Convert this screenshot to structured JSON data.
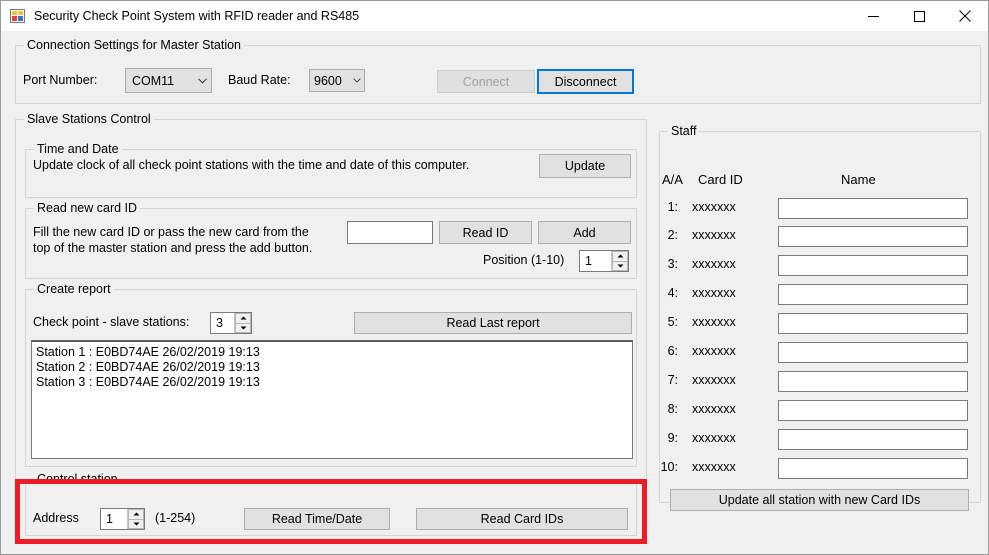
{
  "window": {
    "title": "Security Check Point System with RFID reader and RS485",
    "icon": "app-form-icon",
    "controls": {
      "minimize": "minimize-icon",
      "maximize": "maximize-icon",
      "close": "close-icon"
    }
  },
  "connection": {
    "group_title": "Connection Settings for Master Station",
    "port_label": "Port Number:",
    "port_value": "COM11",
    "baud_label": "Baud Rate:",
    "baud_value": "9600",
    "connect_label": "Connect",
    "connect_disabled": true,
    "disconnect_label": "Disconnect",
    "disconnect_focused": true
  },
  "slave": {
    "group_title": "Slave Stations Control",
    "time_and_date": {
      "group_title": "Time and Date",
      "description": "Update clock of all check point stations with the time and date of this computer.",
      "update_label": "Update"
    },
    "read_new_card": {
      "group_title": "Read new card ID",
      "description_line1": "Fill the new card ID or pass the new card from the",
      "description_line2": "top of the master station and press the add button.",
      "card_id_value": "",
      "card_id_placeholder": "",
      "read_id_label": "Read ID",
      "add_label": "Add",
      "position_label": "Position (1-10)",
      "position_value": "1"
    },
    "create_report": {
      "group_title": "Create report",
      "stations_label": "Check point - slave stations:",
      "stations_value": "3",
      "read_last_report_label": "Read Last report",
      "report_lines": [
        "Station 1 : E0BD74AE 26/02/2019 19:13",
        "Station 2 : E0BD74AE 26/02/2019 19:13",
        "Station 3 : E0BD74AE 26/02/2019 19:13"
      ]
    },
    "control_station": {
      "group_title": "Control station",
      "address_label": "Address",
      "address_value": "1",
      "range_label": "(1-254)",
      "read_time_date_label": "Read Time/Date",
      "read_card_ids_label": "Read Card IDs",
      "highlight_color": "#ed1c24"
    }
  },
  "staff": {
    "group_title": "Staff",
    "columns": {
      "index": "A/A",
      "card_id": "Card ID",
      "name": "Name"
    },
    "rows": [
      {
        "index": "1:",
        "card_id": "xxxxxxx",
        "name": ""
      },
      {
        "index": "2:",
        "card_id": "xxxxxxx",
        "name": ""
      },
      {
        "index": "3:",
        "card_id": "xxxxxxx",
        "name": ""
      },
      {
        "index": "4:",
        "card_id": "xxxxxxx",
        "name": ""
      },
      {
        "index": "5:",
        "card_id": "xxxxxxx",
        "name": ""
      },
      {
        "index": "6:",
        "card_id": "xxxxxxx",
        "name": ""
      },
      {
        "index": "7:",
        "card_id": "xxxxxxx",
        "name": ""
      },
      {
        "index": "8:",
        "card_id": "xxxxxxx",
        "name": ""
      },
      {
        "index": "9:",
        "card_id": "xxxxxxx",
        "name": ""
      },
      {
        "index": "10:",
        "card_id": "xxxxxxx",
        "name": ""
      }
    ],
    "update_all_label": "Update all station with new Card IDs"
  }
}
